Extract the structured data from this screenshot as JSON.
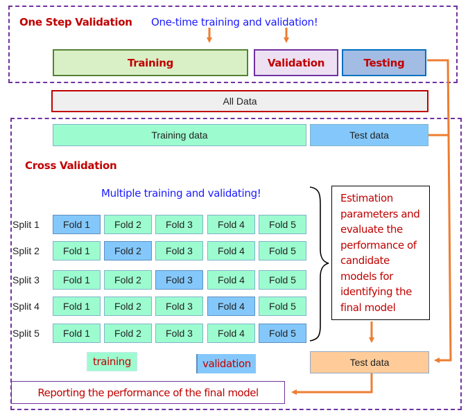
{
  "one_step": {
    "title": "One Step Validation",
    "caption": "One-time training and validation!",
    "segments": [
      {
        "label": "Training"
      },
      {
        "label": "Validation"
      },
      {
        "label": "Testing"
      }
    ]
  },
  "all_data": {
    "label": "All Data"
  },
  "cross_validation": {
    "title": "Cross Validation",
    "training_data_label": "Training data",
    "test_data_label": "Test data",
    "caption": "Multiple training and validating!",
    "splits": [
      {
        "label": "Split 1",
        "validation_fold": 1,
        "folds": [
          "Fold 1",
          "Fold 2",
          "Fold 3",
          "Fold 4",
          "Fold 5"
        ]
      },
      {
        "label": "Split 2",
        "validation_fold": 2,
        "folds": [
          "Fold 1",
          "Fold 2",
          "Fold 3",
          "Fold 4",
          "Fold 5"
        ]
      },
      {
        "label": "Split 3",
        "validation_fold": 3,
        "folds": [
          "Fold 1",
          "Fold 2",
          "Fold 3",
          "Fold 4",
          "Fold 5"
        ]
      },
      {
        "label": "Split 4",
        "validation_fold": 4,
        "folds": [
          "Fold 1",
          "Fold 2",
          "Fold 3",
          "Fold 4",
          "Fold 5"
        ]
      },
      {
        "label": "Split 5",
        "validation_fold": 5,
        "folds": [
          "Fold 1",
          "Fold 2",
          "Fold 3",
          "Fold 4",
          "Fold 5"
        ]
      }
    ],
    "estimation_text": "Estimation parameters and evaluate the performance of candidate models for identifying the final model",
    "legend": {
      "training": "training",
      "validation": "validation"
    },
    "final_test_label": "Test data",
    "report_label": "Reporting the performance of the final model"
  },
  "colors": {
    "dashed_border": "#7030a0",
    "arrow": "#ed7d31",
    "title_red": "#c00000",
    "caption_blue": "#1a1aff",
    "training_fill": "#d9f0c6",
    "validation_fill": "#ede0f3",
    "testing_fill": "#a3bce4",
    "train_fold": "#9cfccf",
    "val_fold": "#84c8fb",
    "final_test_fill": "#ffcc99"
  }
}
